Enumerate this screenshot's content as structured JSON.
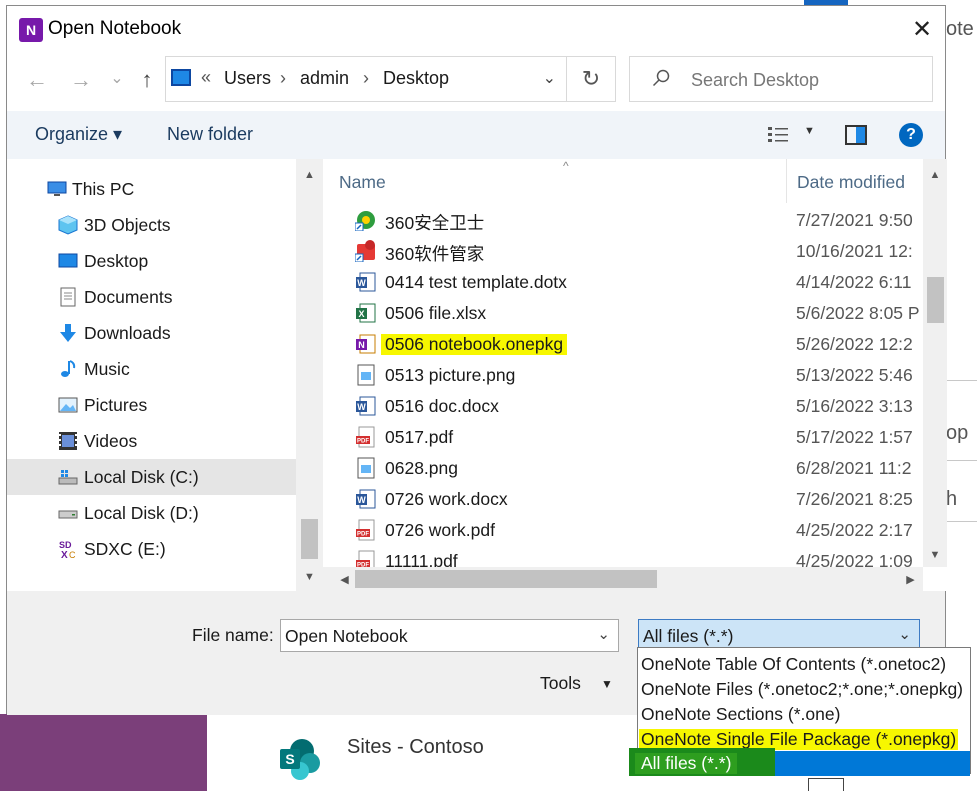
{
  "dialog": {
    "title": "Open Notebook",
    "close_glyph": "✕"
  },
  "nav": {
    "back_glyph": "←",
    "forward_glyph": "→",
    "recent_glyph": "⌄",
    "up_glyph": "↑"
  },
  "address": {
    "chevron": "«",
    "crumbs": [
      "Users",
      "admin",
      "Desktop"
    ],
    "sep": "›",
    "dropdown_glyph": "⌄",
    "refresh_glyph": "↻"
  },
  "search": {
    "placeholder": "Search Desktop"
  },
  "cmdbar": {
    "organize": "Organize ▾",
    "new_folder": "New folder",
    "view_drop": "▼",
    "help": "?"
  },
  "navpane": {
    "items": [
      {
        "label": "This PC",
        "icon": "this-pc-icon"
      },
      {
        "label": "3D Objects",
        "icon": "3d-objects-icon"
      },
      {
        "label": "Desktop",
        "icon": "desktop-icon"
      },
      {
        "label": "Documents",
        "icon": "documents-icon"
      },
      {
        "label": "Downloads",
        "icon": "downloads-icon"
      },
      {
        "label": "Music",
        "icon": "music-icon"
      },
      {
        "label": "Pictures",
        "icon": "pictures-icon"
      },
      {
        "label": "Videos",
        "icon": "videos-icon"
      },
      {
        "label": "Local Disk (C:)",
        "icon": "drive-icon",
        "selected": true
      },
      {
        "label": "Local Disk (D:)",
        "icon": "drive-icon"
      },
      {
        "label": "SDXC (E:)",
        "icon": "sd-card-icon"
      }
    ]
  },
  "filelist": {
    "col_name": "Name",
    "col_date": "Date modified",
    "sort_caret": "^",
    "files": [
      {
        "name": "360安全卫士",
        "date": "7/27/2021 9:50",
        "icon": "shortcut-360-icon"
      },
      {
        "name": "360软件管家",
        "date": "10/16/2021 12:",
        "icon": "shortcut-360-soft-icon"
      },
      {
        "name": "0414 test template.dotx",
        "date": "4/14/2022 6:11",
        "icon": "word-icon"
      },
      {
        "name": "0506 file.xlsx",
        "date": "5/6/2022 8:05 P",
        "icon": "excel-icon"
      },
      {
        "name": "0506 notebook.onepkg",
        "date": "5/26/2022 12:2",
        "icon": "onenote-icon",
        "highlight": true
      },
      {
        "name": "0513 picture.png",
        "date": "5/13/2022 5:46",
        "icon": "image-icon"
      },
      {
        "name": "0516 doc.docx",
        "date": "5/16/2022 3:13",
        "icon": "word-icon"
      },
      {
        "name": "0517.pdf",
        "date": "5/17/2022 1:57",
        "icon": "pdf-icon"
      },
      {
        "name": "0628.png",
        "date": "6/28/2021 11:2",
        "icon": "image-icon"
      },
      {
        "name": "0726 work.docx",
        "date": "7/26/2021 8:25",
        "icon": "word-icon"
      },
      {
        "name": "0726 work.pdf",
        "date": "4/25/2022 2:17",
        "icon": "pdf-icon"
      },
      {
        "name": "11111.pdf",
        "date": "4/25/2022 1:09",
        "icon": "pdf-icon"
      }
    ]
  },
  "bottom": {
    "file_name_label": "File name:",
    "file_name_value": "Open Notebook",
    "file_type_value": "All files (*.*)",
    "tools_label": "Tools",
    "dropdown_glyph": "⌄"
  },
  "filetype_options": [
    "OneNote Table Of Contents (*.onetoc2)",
    "OneNote Files (*.onetoc2;*.one;*.onepkg)",
    "OneNote Sections (*.one)",
    "OneNote Single File Package (*.onepkg)",
    "All files (*.*)"
  ],
  "background": {
    "sites_label": "Sites - Contoso",
    "right_fragments": [
      "ote",
      "op",
      "h"
    ]
  },
  "colors": {
    "highlight": "#f7f700",
    "selection": "#0078d7",
    "onenote_purple": "#7719aa"
  }
}
